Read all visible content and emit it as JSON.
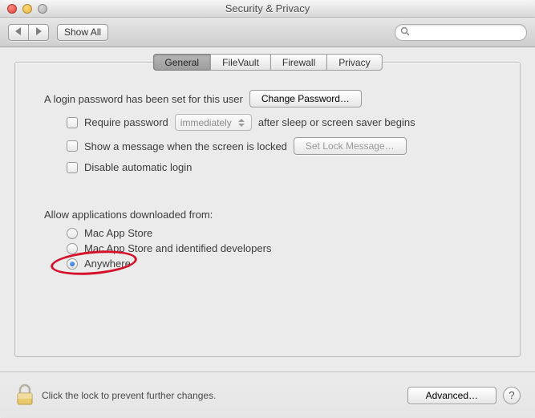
{
  "window": {
    "title": "Security & Privacy"
  },
  "toolbar": {
    "back_label": "◀",
    "forward_label": "▶",
    "show_all_label": "Show All",
    "search_placeholder": ""
  },
  "tabs": [
    {
      "id": "general",
      "label": "General",
      "active": true
    },
    {
      "id": "filevault",
      "label": "FileVault",
      "active": false
    },
    {
      "id": "firewall",
      "label": "Firewall",
      "active": false
    },
    {
      "id": "privacy",
      "label": "Privacy",
      "active": false
    }
  ],
  "general": {
    "password_set_text": "A login password has been set for this user",
    "change_password_label": "Change Password…",
    "require_password_label": "Require password",
    "require_password_delay": "immediately",
    "require_password_suffix": "after sleep or screen saver begins",
    "show_message_label": "Show a message when the screen is locked",
    "set_lock_message_label": "Set Lock Message…",
    "disable_auto_login_label": "Disable automatic login",
    "gatekeeper_heading": "Allow applications downloaded from:",
    "gatekeeper_options": [
      {
        "id": "mas",
        "label": "Mac App Store",
        "selected": false
      },
      {
        "id": "mas_dev",
        "label": "Mac App Store and identified developers",
        "selected": false
      },
      {
        "id": "anywhere",
        "label": "Anywhere",
        "selected": true
      }
    ]
  },
  "footer": {
    "lock_text": "Click the lock to prevent further changes.",
    "advanced_label": "Advanced…",
    "help_label": "?"
  },
  "annotation": {
    "circle_target": "gatekeeper-option-anywhere"
  }
}
